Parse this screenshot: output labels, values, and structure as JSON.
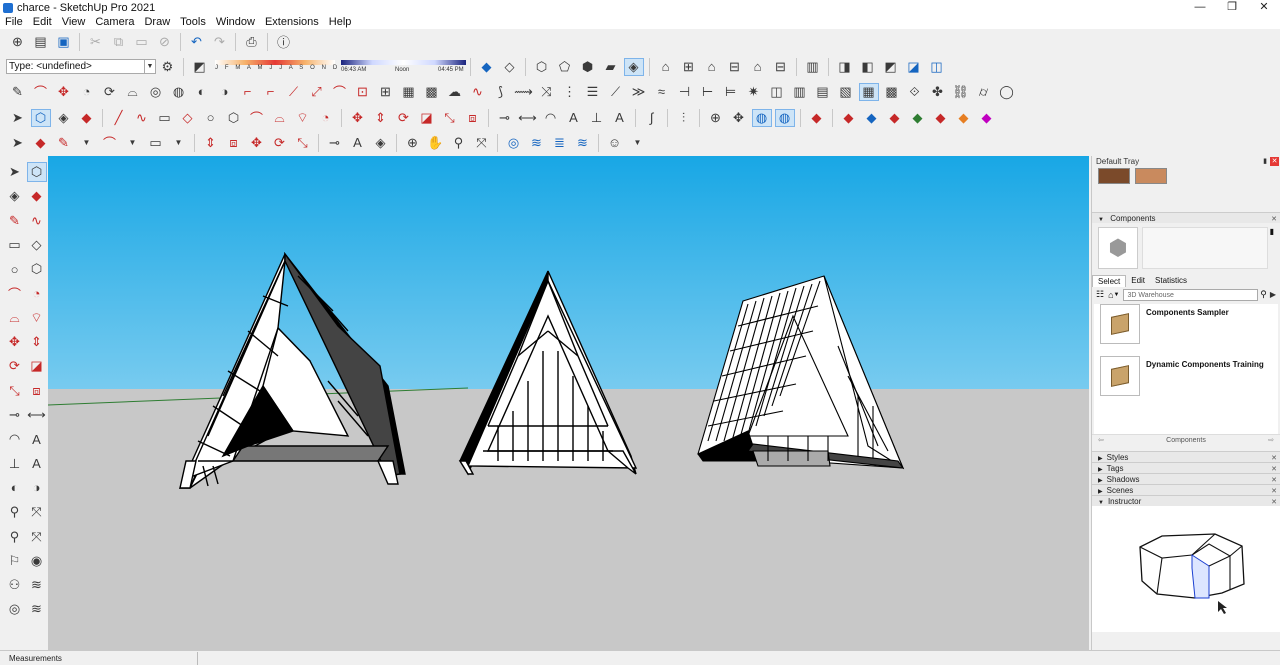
{
  "window": {
    "title": "charce - SketchUp Pro 2021",
    "min": "—",
    "restore": "❐",
    "close": "✕"
  },
  "menu": [
    "File",
    "Edit",
    "View",
    "Camera",
    "Draw",
    "Tools",
    "Window",
    "Extensions",
    "Help"
  ],
  "toolbar_row1": {
    "type_selector": "Type: <undefined>"
  },
  "shadow": {
    "months": "J F M A M J J A S O N D",
    "time_start": "06:43 AM",
    "time_mid": "Noon",
    "time_end": "04:45 PM"
  },
  "tray": {
    "title": "Default Tray",
    "swatches": [
      "#7b4a2a",
      "#c98a5e"
    ],
    "components": {
      "header": "Components",
      "tabs": [
        "Select",
        "Edit",
        "Statistics"
      ],
      "search_placeholder": "3D Warehouse",
      "items": [
        "Components Sampler",
        "Dynamic Components Training"
      ],
      "footer": "Components"
    },
    "panels": [
      "Styles",
      "Tags",
      "Shadows",
      "Scenes",
      "Instructor"
    ]
  },
  "status": {
    "measurements_label": "Measurements"
  }
}
